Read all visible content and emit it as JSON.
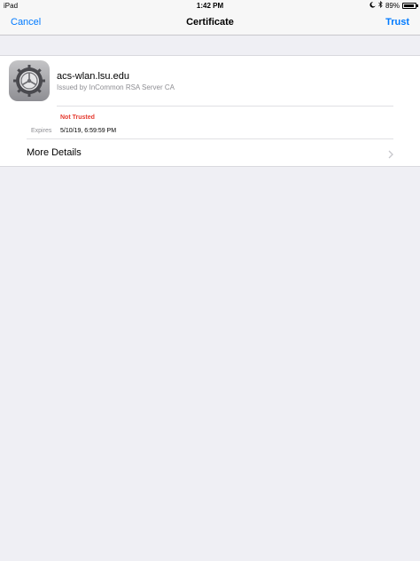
{
  "status_bar": {
    "device": "iPad",
    "time": "1:42 PM",
    "battery": "89%",
    "battery_level": 0.89,
    "icons": [
      "moon-icon",
      "bluetooth-icon",
      "battery-icon"
    ]
  },
  "nav": {
    "cancel": "Cancel",
    "title": "Certificate",
    "trust": "Trust"
  },
  "certificate": {
    "icon": "settings-gear-icon",
    "name": "acs-wlan.lsu.edu",
    "issuer": "Issued by InCommon RSA Server CA",
    "trust_status": "Not Trusted",
    "expires_label": "Expires",
    "expires_value": "5/10/19, 6:59:59 PM"
  },
  "more_details": {
    "label": "More Details",
    "icon": "chevron-right-icon"
  },
  "colors": {
    "accent": "#007aff",
    "warning": "#e53b30",
    "secondary_text": "#8e8e93",
    "background": "#efeff4"
  }
}
